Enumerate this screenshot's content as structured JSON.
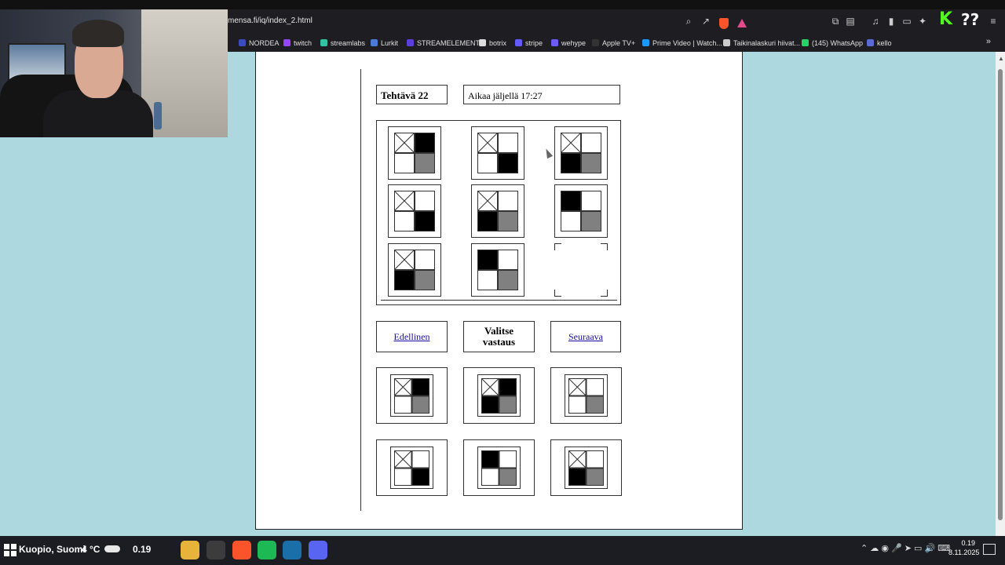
{
  "browser": {
    "url": "mensa.fi/iq/index_2.html",
    "overlay_badge": "??",
    "bookmarks": [
      {
        "label": "NORDEA",
        "color": "#3b4cc0"
      },
      {
        "label": "twitch",
        "color": "#9146ff"
      },
      {
        "label": "streamlabs",
        "color": "#31c3a2"
      },
      {
        "label": "Lurkit",
        "color": "#4a7bd6"
      },
      {
        "label": "STREAMELEMENTS",
        "color": "#5a3ee0"
      },
      {
        "label": "botrix",
        "color": "#dddddd"
      },
      {
        "label": "stripe",
        "color": "#635bff"
      },
      {
        "label": "wehype",
        "color": "#6a5cff"
      },
      {
        "label": "Apple TV+",
        "color": "#333333"
      },
      {
        "label": "Prime Video | Watch...",
        "color": "#1a98ff"
      },
      {
        "label": "Taikinalaskuri hiivat...",
        "color": "#cccccc"
      },
      {
        "label": "(145) WhatsApp",
        "color": "#25d366"
      },
      {
        "label": "kello",
        "color": "#5a6bd6"
      }
    ]
  },
  "test": {
    "question_label": "Tehtävä 22",
    "timer_label": "Aikaa jäljellä 17:27",
    "matrix": [
      [
        {
          "x": 1,
          "k": 2,
          "g": 4
        },
        {
          "x": 1,
          "k": 4
        },
        {
          "x": 1,
          "k": 3,
          "g": 4
        }
      ],
      [
        {
          "x": 1,
          "k": 4
        },
        {
          "x": 1,
          "k": 3,
          "g": 4
        },
        {
          "k": 1,
          "g": 4
        }
      ],
      [
        {
          "x": 1,
          "k": 3,
          "g": 4
        },
        {
          "k": 1,
          "g": 4
        },
        null
      ]
    ],
    "prev_label": "Edellinen",
    "choose_label": "Valitse vastaus",
    "next_label": "Seuraava",
    "answers": [
      {
        "x": 1,
        "k": 2,
        "g": 4
      },
      {
        "x": 1,
        "k": [
          2,
          3
        ],
        "g": 4
      },
      {
        "x": 1,
        "g": 4
      },
      {
        "x": 1,
        "k": 4
      },
      {
        "k": 1,
        "g": 4
      },
      {
        "x": 1,
        "k": 3,
        "g": 4
      }
    ]
  },
  "taskbar": {
    "weather_location": "Kuopio, Suomi",
    "temperature": "4 °C",
    "time_short": "0.19",
    "clock_time": "0.19",
    "clock_date": "8.11.2025",
    "apps": [
      {
        "name": "file-explorer",
        "color": "#e8b33a"
      },
      {
        "name": "obs",
        "color": "#3c3c3c"
      },
      {
        "name": "brave",
        "color": "#fb542b"
      },
      {
        "name": "spotify",
        "color": "#1db954"
      },
      {
        "name": "steam",
        "color": "#1b6fa8"
      },
      {
        "name": "discord",
        "color": "#5865f2"
      }
    ]
  }
}
